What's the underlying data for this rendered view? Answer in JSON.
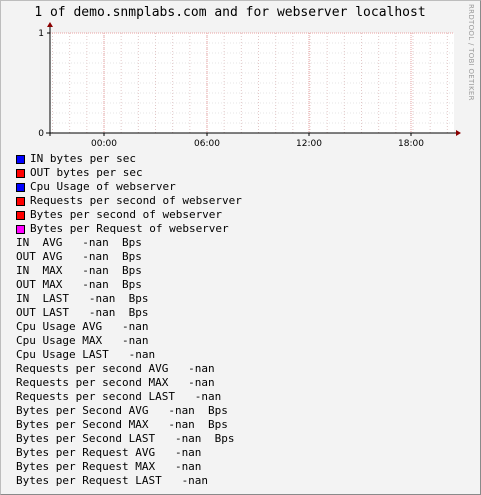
{
  "title": "1 of demo.snmplabs.com and for webserver localhost",
  "watermark": "RRDTOOL / TOBI OETIKER",
  "chart_data": {
    "type": "line",
    "title": "1 of demo.snmplabs.com and for webserver localhost",
    "xlabel": "",
    "ylabel": "",
    "x_ticks": [
      "00:00",
      "06:00",
      "12:00",
      "18:00"
    ],
    "y_ticks": [
      0,
      1
    ],
    "ylim": [
      0,
      1
    ],
    "grid": true,
    "series": [
      {
        "name": "IN bytes per sec",
        "color": "#0000ff",
        "values": []
      },
      {
        "name": "OUT bytes per sec",
        "color": "#ff0000",
        "values": []
      },
      {
        "name": "Cpu Usage of webserver",
        "color": "#0000ff",
        "values": []
      },
      {
        "name": "Requests per second of webserver",
        "color": "#ff0000",
        "values": []
      },
      {
        "name": "Bytes per second of webserver",
        "color": "#ff0000",
        "values": []
      },
      {
        "name": "Bytes per Request of webserver",
        "color": "#ff00ff",
        "values": []
      }
    ]
  },
  "stats": [
    "IN  AVG   -nan  Bps",
    "OUT AVG   -nan  Bps",
    "IN  MAX   -nan  Bps",
    "OUT MAX   -nan  Bps",
    "IN  LAST   -nan  Bps",
    "OUT LAST   -nan  Bps",
    "Cpu Usage AVG   -nan",
    "Cpu Usage MAX   -nan",
    "Cpu Usage LAST   -nan",
    "Requests per second AVG   -nan",
    "Requests per second MAX   -nan",
    "Requests per second LAST   -nan",
    "Bytes per Second AVG   -nan  Bps",
    "Bytes per Second MAX   -nan  Bps",
    "Bytes per Second LAST   -nan  Bps",
    "Bytes per Request AVG   -nan",
    "Bytes per Request MAX   -nan",
    "Bytes per Request LAST   -nan"
  ]
}
